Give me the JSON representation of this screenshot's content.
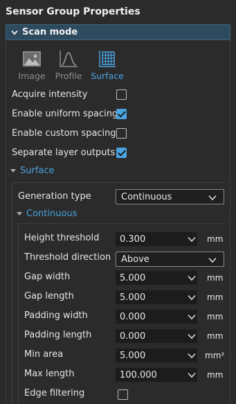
{
  "title": "Sensor Group Properties",
  "section": {
    "label": "Scan mode"
  },
  "modes": [
    {
      "label": "Image",
      "icon": "image-icon",
      "active": false
    },
    {
      "label": "Profile",
      "icon": "profile-icon",
      "active": false
    },
    {
      "label": "Surface",
      "icon": "surface-icon",
      "active": true
    }
  ],
  "options": [
    {
      "label": "Acquire intensity",
      "checked": false
    },
    {
      "label": "Enable uniform spacing",
      "checked": true
    },
    {
      "label": "Enable custom spacing",
      "checked": false
    },
    {
      "label": "Separate layer outputs",
      "checked": true
    }
  ],
  "surface": {
    "label": "Surface",
    "generation_type_label": "Generation type",
    "generation_type_value": "Continuous",
    "continuous": {
      "label": "Continuous",
      "params": [
        {
          "label": "Height threshold",
          "value": "0.300",
          "unit": "mm"
        },
        {
          "label": "Threshold direction",
          "value": "Above",
          "unit": ""
        },
        {
          "label": "Gap width",
          "value": "5.000",
          "unit": "mm"
        },
        {
          "label": "Gap length",
          "value": "5.000",
          "unit": "mm"
        },
        {
          "label": "Padding width",
          "value": "0.000",
          "unit": "mm"
        },
        {
          "label": "Padding length",
          "value": "0.000",
          "unit": "mm"
        },
        {
          "label": "Min area",
          "value": "5.000",
          "unit": "mm²"
        },
        {
          "label": "Max length",
          "value": "100.000",
          "unit": "mm"
        }
      ],
      "edge_filtering_label": "Edge filtering",
      "edge_filtering_checked": false
    }
  },
  "colors": {
    "accent": "#4aa3e0",
    "background": "#2b2b2b",
    "section_bar": "#2e4a5e"
  }
}
